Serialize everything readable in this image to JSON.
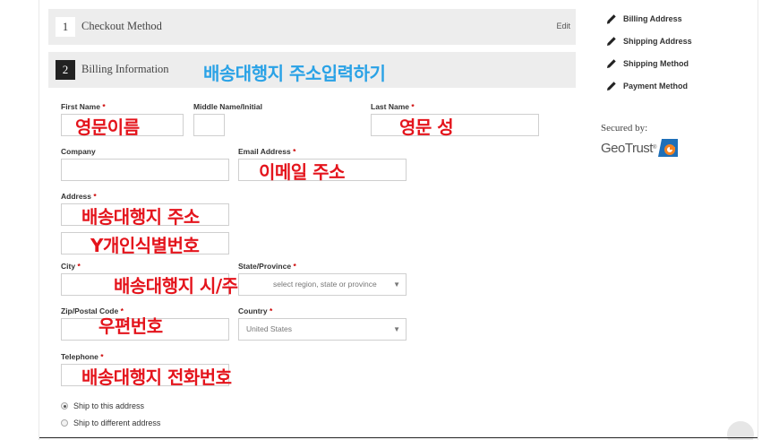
{
  "steps": [
    {
      "number": "1",
      "title": "Checkout Method",
      "edit": "Edit"
    },
    {
      "number": "2",
      "title": "Billing Information"
    }
  ],
  "form": {
    "first_name_label": "First Name",
    "middle_name_label": "Middle Name/Initial",
    "last_name_label": "Last Name",
    "company_label": "Company",
    "email_label": "Email Address",
    "address_label": "Address",
    "city_label": "City",
    "state_label": "State/Province",
    "state_placeholder": "select region, state or province",
    "zip_label": "Zip/Postal Code",
    "country_label": "Country",
    "country_value": "United States",
    "telephone_label": "Telephone",
    "required_mark": "*"
  },
  "shipping_options": {
    "same": "Ship to this address",
    "different": "Ship to different address"
  },
  "annotations": {
    "title": "배송대행지 주소입력하기",
    "first_name": "영문이름",
    "last_name": "영문 성",
    "email": "이메일 주소",
    "address1": "배송대행지 주소",
    "address2": "Y개인식별번호",
    "city_state": "배송대행지 시/주",
    "zip": "우편번호",
    "telephone": "배송대행지 전화번호"
  },
  "sidebar": {
    "items": [
      "Billing Address",
      "Shipping Address",
      "Shipping Method",
      "Payment Method"
    ],
    "secured_by": "Secured by:",
    "geotrust": "GeoTrust",
    "geotrust_reg": "®"
  },
  "colors": {
    "annotation_red": "#e4141c",
    "annotation_blue": "#2aa2e6",
    "step_bg": "#ededed",
    "geotrust_blue": "#1e6fb8",
    "geotrust_orange": "#f58220"
  }
}
